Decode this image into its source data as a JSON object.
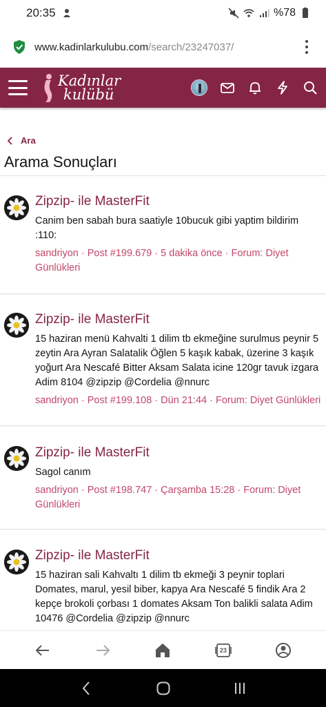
{
  "status_bar": {
    "time": "20:35",
    "battery": "%78"
  },
  "url_bar": {
    "domain": "www.kadinlarkulubu.com",
    "path": "/search/23247037/"
  },
  "site_header": {
    "logo_line1": "Kadınlar",
    "logo_line2": "kulübü"
  },
  "breadcrumb": {
    "label": "Ara"
  },
  "page_title": "Arama Sonuçları",
  "results": [
    {
      "title": "Zipzip- ile MasterFit",
      "snippet": "Canim ben sabah bura saatiyle 10bucuk gibi yaptim bildirim :110:",
      "meta": "sandriyon · Post #199.679 · 5 dakika önce · Forum: Diyet Günlükleri"
    },
    {
      "title": "Zipzip- ile MasterFit",
      "snippet": "15 haziran menü Kahvalti 1 dilim tb ekmeğine surulmus peynir 5 zeytin Ara Ayran Salatalik Öğlen 5 kaşık kabak, üzerine 3 kaşık yoğurt Ara Nescafé Bitter Aksam Salata icine 120gr tavuk izgara Adim 8104 @zipzip @Cordelia @nnurc",
      "meta": "sandriyon · Post #199.108 · Dün 21:44 · Forum: Diyet Günlükleri"
    },
    {
      "title": "Zipzip- ile MasterFit",
      "snippet": "Sagol canım",
      "meta": "sandriyon · Post #198.747 · Çarşamba 15:28 · Forum: Diyet Günlükleri"
    },
    {
      "title": "Zipzip- ile MasterFit",
      "snippet": "15 haziran sali Kahvaltı 1 dilim tb ekmeği 3 peynir toplari Domates, marul, yesil biber, kapya Ara Nescafé 5 findik Ara 2 kepçe brokoli çorbası 1 domates Aksam Ton balikli salata Adim 10476 @Cordelia @zipzip @nnurc",
      "meta": ""
    }
  ],
  "browser_nav": {
    "tab_count": "23"
  },
  "colors": {
    "brand": "#852545",
    "meta": "#c2476a"
  }
}
